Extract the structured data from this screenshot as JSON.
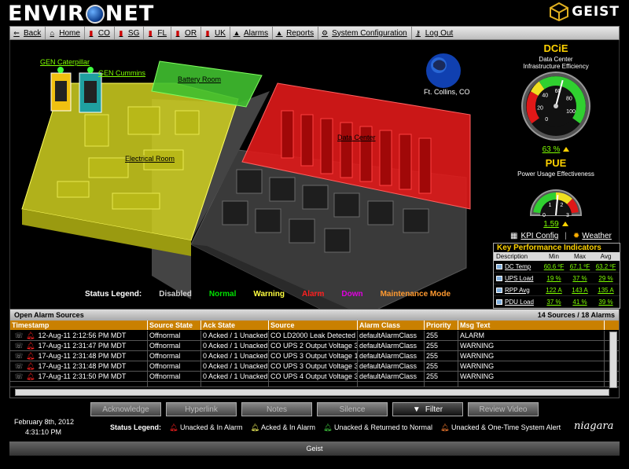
{
  "header": {
    "logo_left": "ENVIR",
    "logo_right": "NET",
    "brand": "GEIST"
  },
  "nav": [
    {
      "label": "Back",
      "icon": "back-arrow-icon"
    },
    {
      "label": "Home",
      "icon": "home-icon"
    },
    {
      "label": "CO",
      "icon": "chart-icon"
    },
    {
      "label": "SG",
      "icon": "chart-icon"
    },
    {
      "label": "FL",
      "icon": "chart-icon"
    },
    {
      "label": "OR",
      "icon": "chart-icon"
    },
    {
      "label": "UK",
      "icon": "chart-icon"
    },
    {
      "label": "Alarms",
      "icon": "alarm-icon"
    },
    {
      "label": "Reports",
      "icon": "report-icon"
    },
    {
      "label": "System Configuration",
      "icon": "gear-icon"
    },
    {
      "label": "Log Out",
      "icon": "key-icon"
    }
  ],
  "floorplan": {
    "gen1": "GEN Caterpillar",
    "gen2": "GEN Cummins",
    "battery": "Battery Room",
    "electrical": "Electrical Room",
    "datacenter": "Data Center",
    "site": "Ft. Collins, CO"
  },
  "status_legend": {
    "label": "Status Legend:",
    "items": [
      {
        "text": "Disabled",
        "color": "#d0d0d0"
      },
      {
        "text": "Normal",
        "color": "#00e000"
      },
      {
        "text": "Warning",
        "color": "#ffff40"
      },
      {
        "text": "Alarm",
        "color": "#ff2020"
      },
      {
        "text": "Down",
        "color": "#e000e0"
      },
      {
        "text": "Maintenance Mode",
        "color": "#ff9a30"
      }
    ]
  },
  "dcie": {
    "title": "DCiE",
    "subtitle1": "Data Center",
    "subtitle2": "Infrastructure Efficiency",
    "value": "63 %",
    "value_num": 63,
    "ticks": [
      "0",
      "10",
      "20",
      "30",
      "40",
      "50",
      "60",
      "70",
      "80",
      "90",
      "100"
    ]
  },
  "pue": {
    "title": "PUE",
    "subtitle": "Power Usage Effectiveness",
    "value": "1.59",
    "value_num": 1.59,
    "ticks": [
      "0",
      "1",
      "2",
      "3"
    ]
  },
  "kpi_links": {
    "config": "KPI Config",
    "weather": "Weather"
  },
  "kpi": {
    "title": "Key Performance Indicators",
    "headers": [
      "Description",
      "Min",
      "Max",
      "Avg"
    ],
    "rows": [
      {
        "desc": "DC Temp",
        "min": "60.6 ºF",
        "max": "67.1 ºF",
        "avg": "63.2 ºF"
      },
      {
        "desc": "UPS Load",
        "min": "19 %",
        "max": "37 %",
        "avg": "29 %"
      },
      {
        "desc": "RPP Avg",
        "min": "122 A",
        "max": "143 A",
        "avg": "135 A"
      },
      {
        "desc": "PDU Load",
        "min": "37 %",
        "max": "41 %",
        "avg": "39 %"
      }
    ]
  },
  "alarms": {
    "title": "Open Alarm Sources",
    "summary": "14 Sources / 18 Alarms",
    "columns": [
      "Timestamp",
      "Source State",
      "Ack State",
      "Source",
      "Alarm Class",
      "Priority",
      "Msg Text"
    ],
    "rows": [
      [
        "12-Aug-11 2:12:56 PM MDT",
        "Offnormal",
        "0 Acked / 1 Unacked",
        "CO LD2000 Leak Detected",
        "defaultAlarmClass",
        "255",
        "ALARM"
      ],
      [
        "17-Aug-11 2:31:47 PM MDT",
        "Offnormal",
        "0 Acked / 1 Unacked",
        "CO UPS 2 Output Voltage 3",
        "defaultAlarmClass",
        "255",
        "WARNING"
      ],
      [
        "17-Aug-11 2:31:48 PM MDT",
        "Offnormal",
        "0 Acked / 1 Unacked",
        "CO UPS 3 Output Voltage 1",
        "defaultAlarmClass",
        "255",
        "WARNING"
      ],
      [
        "17-Aug-11 2:31:48 PM MDT",
        "Offnormal",
        "0 Acked / 1 Unacked",
        "CO UPS 3 Output Voltage 3",
        "defaultAlarmClass",
        "255",
        "WARNING"
      ],
      [
        "17-Aug-11 2:31:50 PM MDT",
        "Offnormal",
        "0 Acked / 1 Unacked",
        "CO UPS 4 Output Voltage 3",
        "defaultAlarmClass",
        "255",
        "WARNING"
      ]
    ]
  },
  "buttons": [
    "Acknowledge",
    "Hyperlink",
    "Notes",
    "Silence",
    "Filter",
    "Review Video"
  ],
  "date": {
    "date": "February 8th, 2012",
    "time": "4:31:10 PM"
  },
  "bottom_legend": {
    "label": "Status Legend:",
    "items": [
      {
        "text": "Unacked & In Alarm",
        "color": "#ff2020"
      },
      {
        "text": "Acked & In Alarm",
        "color": "#ffff60"
      },
      {
        "text": "Unacked & Returned to Normal",
        "color": "#40d040"
      },
      {
        "text": "Unacked & One-Time System Alert",
        "color": "#ff8030"
      }
    ]
  },
  "niagara": "niagara",
  "footer": "Geist"
}
